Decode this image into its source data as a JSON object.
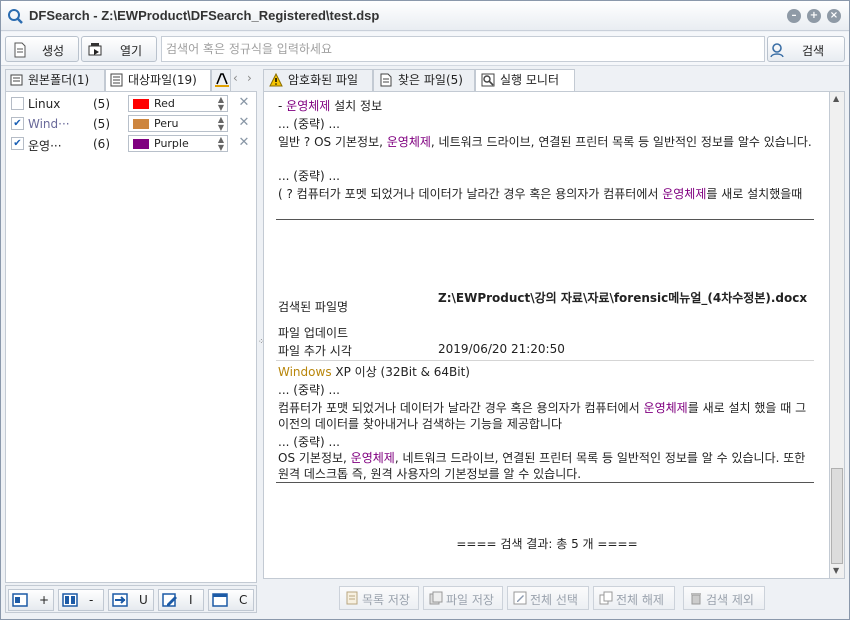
{
  "window": {
    "title": "DFSearch - Z:\\EWProduct\\DFSearch_Registered\\test.dsp",
    "controls": [
      "minimize-icon",
      "maximize-icon",
      "close-icon"
    ]
  },
  "toolbar": {
    "create_label": "생성",
    "open_label": "열기",
    "search_placeholder": "검색어 혹은 정규식을 입력하세요",
    "search_label": "검색"
  },
  "left_tabs": [
    {
      "label": "원본폴더(1)",
      "icon": "keyboard-icon"
    },
    {
      "label": "대상파일(19)",
      "icon": "file-list-icon"
    },
    {
      "label": "",
      "icon": "font-color-icon"
    }
  ],
  "keywords": [
    {
      "checked": false,
      "name": "Linux",
      "count": "(5)",
      "color_name": "Red",
      "color": "#ff0000"
    },
    {
      "checked": true,
      "name": "Wind···",
      "count": "(5)",
      "color_name": "Peru",
      "color": "#cd853f"
    },
    {
      "checked": true,
      "name": "운영···",
      "count": "(6)",
      "color_name": "Purple",
      "color": "#800080"
    }
  ],
  "left_bottom": [
    {
      "label": "+",
      "icon": "add-icon"
    },
    {
      "label": "-",
      "icon": "remove-icon"
    },
    {
      "label": "U",
      "icon": "update-icon"
    },
    {
      "label": "I",
      "icon": "edit-icon"
    },
    {
      "label": "C",
      "icon": "window-icon"
    }
  ],
  "right_tabs": [
    {
      "label": "암호화된 파일",
      "icon": "warning-icon"
    },
    {
      "label": "찾은 파일(5)",
      "icon": "document-icon"
    },
    {
      "label": "실행 모니터",
      "icon": "monitor-icon"
    }
  ],
  "content": {
    "block1": {
      "line1_prefix": "- ",
      "line1_kw": "운영체제",
      "line1_rest": " 설치 정보",
      "omit": "... (중략) ...",
      "p1_a": "일반 ? OS 기본정보, ",
      "p1_kw": "운영체제",
      "p1_b": ", 네트워크 드라이브, 연결된 프린터 목록 등 일반적인 정보를 알수 있습니다.",
      "p2_a": "( ? 컴퓨터가 포멧 되었거나 데이터가 날라간 경우 혹은 용의자가 컴퓨터에서 ",
      "p2_kw": "운영체제",
      "p2_b": "를 새로 설치했을때"
    },
    "file": {
      "found_label": "검색된 파일명",
      "found_value": "Z:\\EWProduct\\강의 자료\\자료\\forensic메뉴얼_(4차수정본).docx",
      "update_label": "파일 업데이트",
      "added_label": "파일 추가 시각",
      "added_value": "2019/06/20 21:20:50"
    },
    "block2": {
      "l1_kw": "Windows",
      "l1_rest": " XP 이상 (32Bit & 64Bit)",
      "p1_a": "컴퓨터가 포맷 되었거나 데이터가 날라간 경우 혹은 용의자가 컴퓨터에서 ",
      "p1_kw": "운영체제",
      "p1_b": "를 새로 설치 했을 때 그 이전의 데이터를 찾아내거나 검색하는 기능을 제공합니다",
      "p2_a": "OS 기본정보, ",
      "p2_kw": "운영체제",
      "p2_b": ", 네트워크 드라이브, 연결된 프린터 목록 등 일반적인 정보를 알 수 있습니다. 또한 원격 데스크톱 즉, 원격 사용자의 기본정보를 알 수 있습니다."
    },
    "result": "==== 검색 결과: 총 5 개 ===="
  },
  "right_bottom": [
    {
      "label": "목록 저장",
      "icon": "list-save-icon"
    },
    {
      "label": "파일 저장",
      "icon": "file-save-icon"
    },
    {
      "label": "전체 선택",
      "icon": "select-all-icon"
    },
    {
      "label": "전체 해제",
      "icon": "deselect-all-icon"
    },
    {
      "label": "검색 제외",
      "icon": "trash-icon"
    }
  ],
  "colors": {
    "keyword_purple": "#800080",
    "keyword_peru": "#b8860b",
    "disabled_text": "#9aa2ad"
  }
}
